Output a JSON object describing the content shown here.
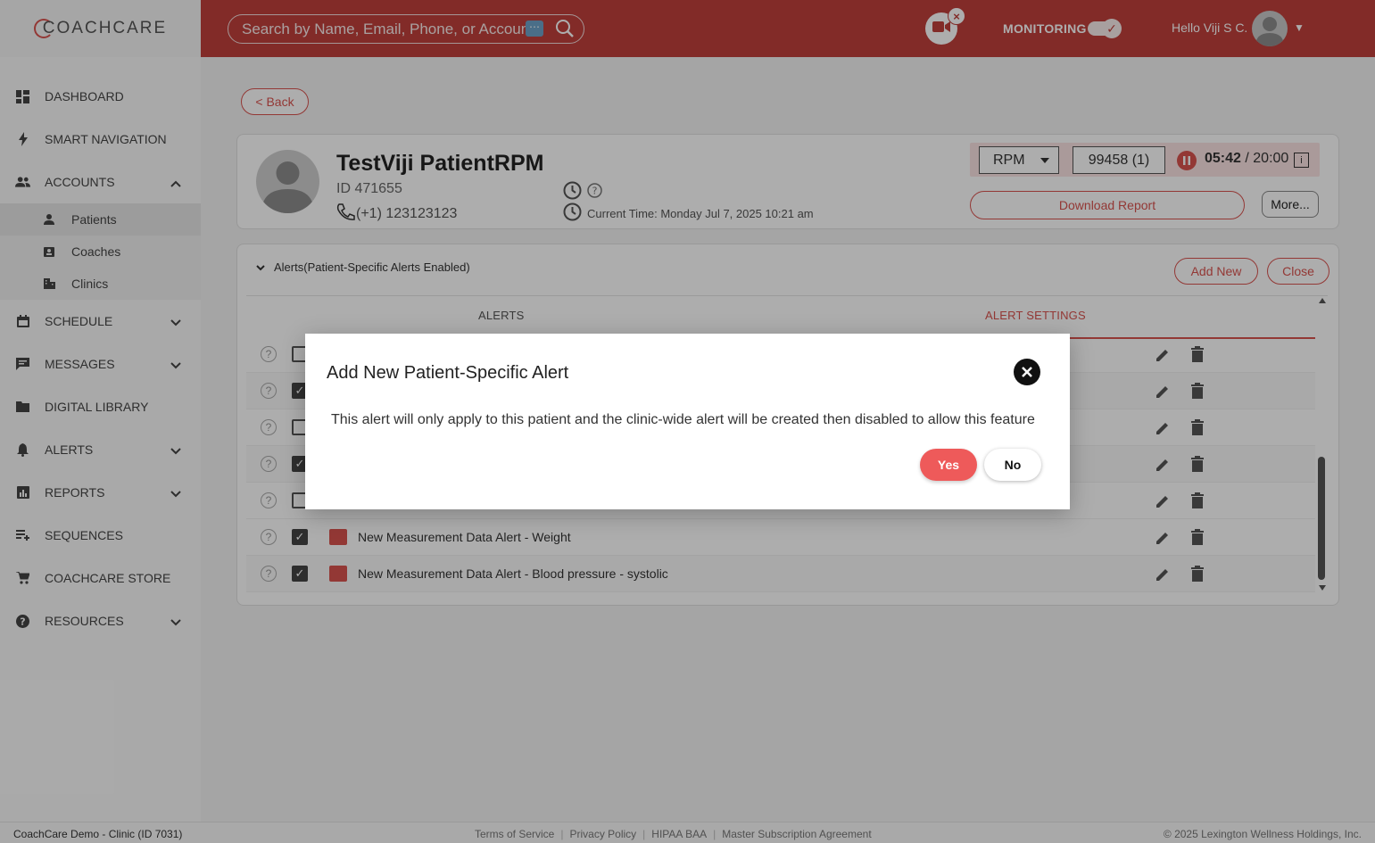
{
  "app": {
    "logo_text": "COACHCARE"
  },
  "header": {
    "search_placeholder": "Search by Name, Email, Phone, or Account I",
    "search_more": "⋯",
    "video_close": "×",
    "monitoring_label": "MONITORING",
    "greeting": "Hello Viji S C.",
    "accent_color": "#c0403c"
  },
  "sidebar": {
    "items": [
      {
        "label": "DASHBOARD",
        "icon": "dashboard-icon"
      },
      {
        "label": "SMART NAVIGATION",
        "icon": "lightning-icon"
      },
      {
        "label": "ACCOUNTS",
        "icon": "people-icon",
        "expanded": true
      },
      {
        "label": "SCHEDULE",
        "icon": "calendar-icon"
      },
      {
        "label": "MESSAGES",
        "icon": "chat-icon"
      },
      {
        "label": "DIGITAL LIBRARY",
        "icon": "folder-icon"
      },
      {
        "label": "ALERTS",
        "icon": "bell-icon"
      },
      {
        "label": "REPORTS",
        "icon": "report-icon"
      },
      {
        "label": "SEQUENCES",
        "icon": "playlist-icon"
      },
      {
        "label": "COACHCARE STORE",
        "icon": "cart-icon"
      },
      {
        "label": "RESOURCES",
        "icon": "help-icon"
      }
    ],
    "accounts_sub": [
      {
        "label": "Patients",
        "icon": "person-icon"
      },
      {
        "label": "Coaches",
        "icon": "badge-icon"
      },
      {
        "label": "Clinics",
        "icon": "building-icon"
      }
    ]
  },
  "main": {
    "back_label": "< Back",
    "patient": {
      "name": "TestViji PatientRPM",
      "id": "ID 471655",
      "phone": "(+1) 123123123",
      "current_time": "Current Time: Monday Jul 7, 2025 10:21 am"
    },
    "rpm": {
      "program": "RPM",
      "code": "99458 (1)",
      "timer_elapsed": "05:42",
      "timer_total": "/ 20:00",
      "info": "i"
    },
    "download_report": "Download Report",
    "more": "More...",
    "alerts": {
      "heading": "Alerts",
      "heading_note": "(Patient-Specific Alerts Enabled)",
      "add_new": "Add New",
      "close": "Close",
      "tab_alerts": "ALERTS",
      "tab_settings": "ALERT SETTINGS",
      "rows": [
        {
          "checked": false,
          "label": ""
        },
        {
          "checked": true,
          "label": ""
        },
        {
          "checked": false,
          "label": ""
        },
        {
          "checked": true,
          "label": ""
        },
        {
          "checked": false,
          "label": ""
        },
        {
          "checked": true,
          "label": "New Measurement Data Alert - Weight"
        },
        {
          "checked": true,
          "label": "New Measurement Data Alert - Blood pressure - systolic"
        }
      ]
    }
  },
  "modal": {
    "title": "Add New Patient-Specific Alert",
    "body": "This alert will only apply to this patient and the clinic-wide alert will be created then disabled to allow this feature",
    "yes": "Yes",
    "no": "No"
  },
  "footer": {
    "clinic": "CoachCare Demo - Clinic (ID 7031)",
    "links": [
      "Terms of Service",
      "Privacy Policy",
      "HIPAA BAA",
      "Master Subscription Agreement"
    ],
    "copyright": "© 2025 Lexington Wellness Holdings, Inc."
  }
}
